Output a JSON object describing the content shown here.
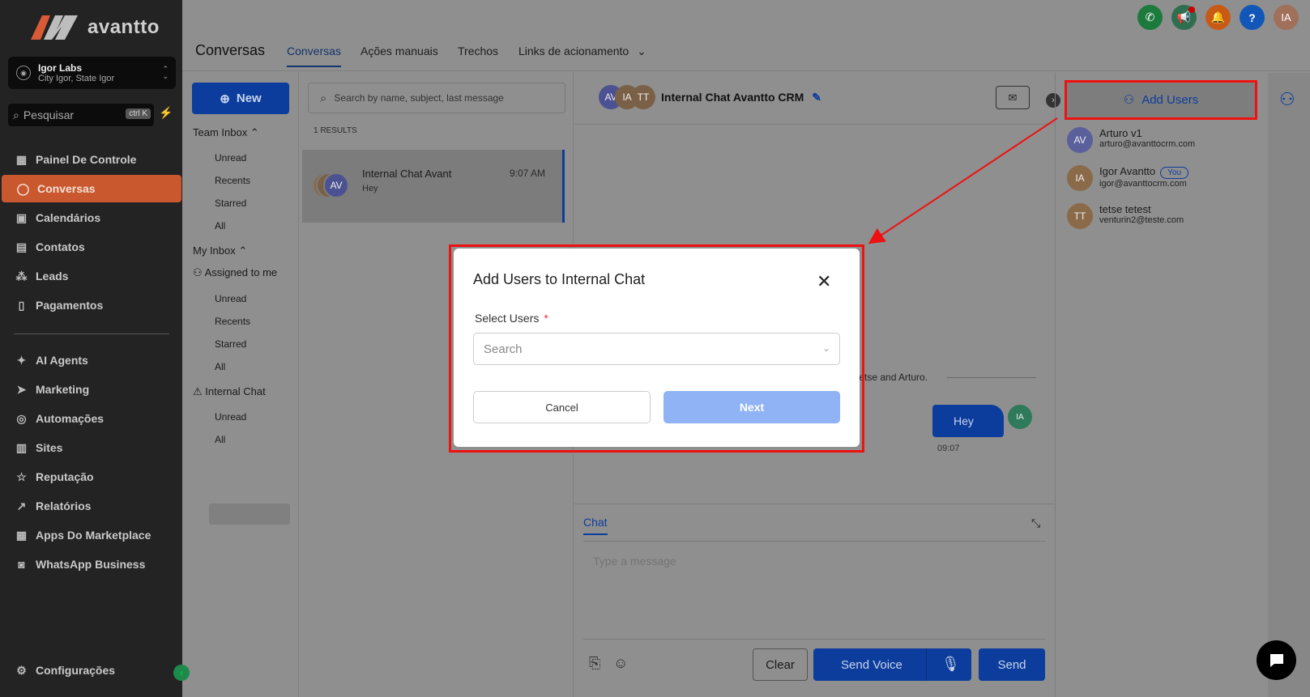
{
  "brand": {
    "name": "avantto"
  },
  "location": {
    "name": "Igor Labs",
    "sub": "City Igor, State Igor"
  },
  "sidebar_search": {
    "placeholder": "Pesquisar",
    "shortcut": "ctrl K"
  },
  "nav": [
    {
      "label": "Painel De Controle",
      "icon": "dashboard-icon"
    },
    {
      "label": "Conversas",
      "icon": "chat-icon",
      "active": true
    },
    {
      "label": "Calendários",
      "icon": "calendar-icon"
    },
    {
      "label": "Contatos",
      "icon": "contacts-icon"
    },
    {
      "label": "Leads",
      "icon": "leads-icon"
    },
    {
      "label": "Pagamentos",
      "icon": "payments-icon"
    },
    {
      "label": "AI Agents",
      "icon": "sparkle-icon"
    },
    {
      "label": "Marketing",
      "icon": "send-icon"
    },
    {
      "label": "Automações",
      "icon": "automation-icon"
    },
    {
      "label": "Sites",
      "icon": "sites-icon"
    },
    {
      "label": "Reputação",
      "icon": "star-icon"
    },
    {
      "label": "Relatórios",
      "icon": "chart-icon"
    },
    {
      "label": "Apps Do Marketplace",
      "icon": "apps-icon"
    },
    {
      "label": "WhatsApp Business",
      "icon": "whatsapp-icon"
    }
  ],
  "settings": {
    "label": "Configurações"
  },
  "header": {
    "title": "Conversas",
    "tabs": [
      "Conversas",
      "Ações manuais",
      "Trechos",
      "Links de acionamento"
    ]
  },
  "top_icons": {
    "phone_color": "#1c7a3d",
    "megaphone_color": "#2f6e4f",
    "bell_color": "#c85a16",
    "help_color": "#1256b8",
    "avatar_initials": "IA",
    "avatar_color": "#a0705a"
  },
  "inbox": {
    "new_label": "New",
    "team_inbox": "Team Inbox",
    "team_items": [
      "Unread",
      "Recents",
      "Starred",
      "All"
    ],
    "my_inbox": "My Inbox",
    "assigned": "Assigned to me",
    "my_items": [
      "Unread",
      "Recents",
      "Starred",
      "All"
    ],
    "internal_chat": "Internal Chat",
    "internal_items": [
      "Unread",
      "All"
    ]
  },
  "conversations": {
    "search_placeholder": "Search by name, subject, last message",
    "results": "1 RESULTS",
    "items": [
      {
        "name": "Internal Chat Avant",
        "time": "9:07 AM",
        "preview": "Hey",
        "avatar": "AV"
      }
    ]
  },
  "chat": {
    "title": "Internal Chat Avantto CRM",
    "avatars": [
      "AV",
      "IA",
      "TT"
    ],
    "system_message": "tetse and Arturo.",
    "message": {
      "text": "Hey",
      "time": "09:07",
      "avatar": "IA"
    },
    "composer_tab": "Chat",
    "composer_placeholder": "Type a message",
    "clear": "Clear",
    "send_voice": "Send Voice",
    "send": "Send"
  },
  "right_panel": {
    "add_users": "Add Users",
    "users": [
      {
        "initials": "AV",
        "name": "Arturo v1",
        "email": "arturo@avanttocrm.com",
        "color": "#5b5f9c"
      },
      {
        "initials": "IA",
        "name": "Igor Avantto",
        "email": "igor@avanttocrm.com",
        "badge": "You",
        "color": "#8a6a48"
      },
      {
        "initials": "TT",
        "name": "tetse tetest",
        "email": "venturin2@teste.com",
        "color": "#8a6a48"
      }
    ]
  },
  "modal": {
    "title": "Add Users to Internal Chat",
    "label": "Select Users",
    "required_mark": "*",
    "search_placeholder": "Search",
    "cancel": "Cancel",
    "next": "Next"
  }
}
